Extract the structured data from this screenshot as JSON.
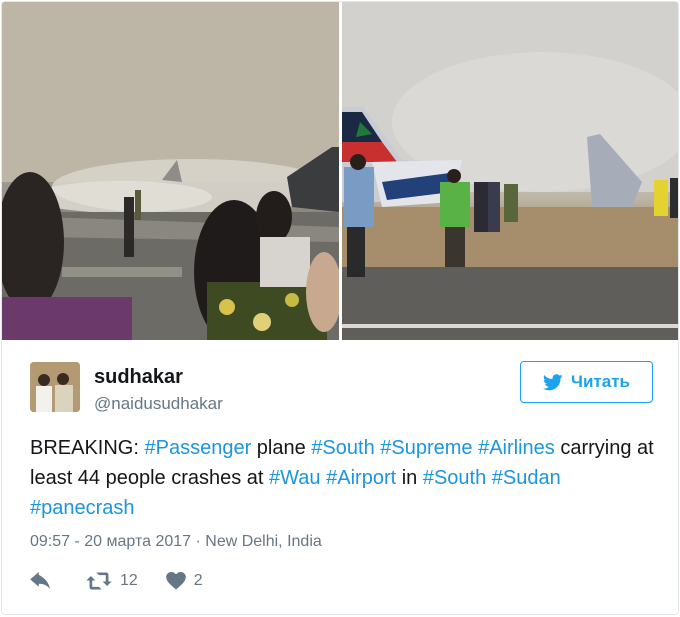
{
  "tweet": {
    "photos": [
      {
        "name": "crash-photo-left"
      },
      {
        "name": "crash-photo-right"
      }
    ],
    "author": {
      "display_name": "sudhakar",
      "username": "@naidusudhakar"
    },
    "follow_button": {
      "label": "Читать",
      "icon": "twitter-bird-icon"
    },
    "text_segments": [
      {
        "text": "BREAKING: ",
        "link": false
      },
      {
        "text": "#Passenger",
        "link": true
      },
      {
        "text": " plane ",
        "link": false
      },
      {
        "text": "#South",
        "link": true
      },
      {
        "text": " ",
        "link": false
      },
      {
        "text": "#Supreme",
        "link": true
      },
      {
        "text": " ",
        "link": false
      },
      {
        "text": "#Airlines",
        "link": true
      },
      {
        "text": " carrying at least 44 people crashes at ",
        "link": false
      },
      {
        "text": "#Wau",
        "link": true
      },
      {
        "text": " ",
        "link": false
      },
      {
        "text": "#Airport",
        "link": true
      },
      {
        "text": " in ",
        "link": false
      },
      {
        "text": "#South",
        "link": true
      },
      {
        "text": " ",
        "link": false
      },
      {
        "text": "#Sudan",
        "link": true
      },
      {
        "text": " ",
        "link": false
      },
      {
        "text": "#panecrash",
        "link": true
      }
    ],
    "timestamp": "09:57 - 20 марта 2017",
    "separator": "·",
    "location": "New Delhi, India",
    "actions": {
      "reply": {
        "icon": "reply-icon"
      },
      "retweet": {
        "icon": "retweet-icon",
        "count": "12"
      },
      "like": {
        "icon": "heart-icon",
        "count": "2"
      }
    }
  },
  "colors": {
    "link": "#1b95e0",
    "twitter_blue": "#1da1f2",
    "muted": "#657786",
    "text": "#14171a",
    "border": "#e1e8ed"
  }
}
